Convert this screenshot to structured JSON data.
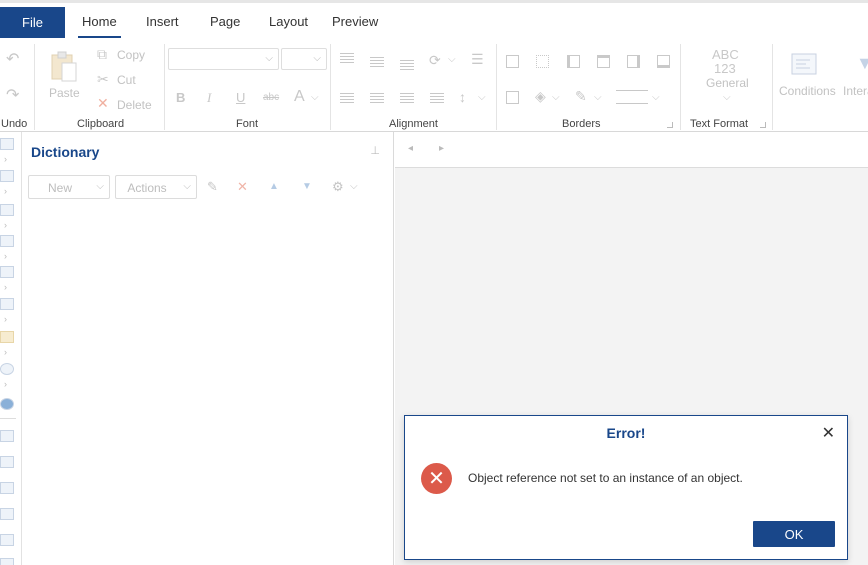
{
  "tabs": {
    "file": "File",
    "items": [
      "Home",
      "Insert",
      "Page",
      "Layout",
      "Preview"
    ]
  },
  "ribbon": {
    "undo": {
      "label": "Undo"
    },
    "clipboard": {
      "label": "Clipboard",
      "paste": "Paste",
      "copy": "Copy",
      "cut": "Cut",
      "delete": "Delete"
    },
    "font": {
      "label": "Font"
    },
    "alignment": {
      "label": "Alignment"
    },
    "borders": {
      "label": "Borders"
    },
    "text_format": {
      "label": "Text Format",
      "abc": "ABC",
      "num": "123",
      "general": "General"
    },
    "conditions": "Conditions",
    "interaction": "Intera"
  },
  "dictionary": {
    "title": "Dictionary",
    "new_label": "New",
    "actions_label": "Actions"
  },
  "dialog": {
    "title": "Error!",
    "message": "Object reference not set to an instance of an object.",
    "ok": "OK"
  },
  "colors": {
    "accent": "#19478a",
    "error": "#dc5a4a"
  }
}
